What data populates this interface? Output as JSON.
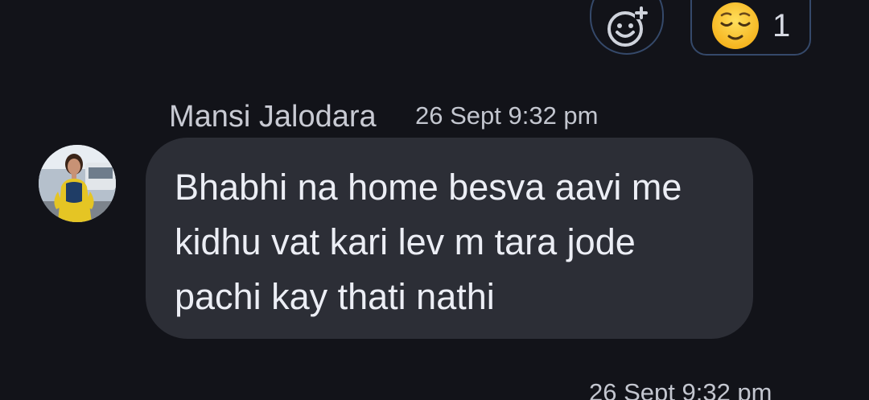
{
  "reactions": {
    "add_reaction_icon": "add-emoji-icon",
    "chip": {
      "emoji_icon": "relieved-face-emoji",
      "count": "1"
    }
  },
  "message": {
    "sender": "Mansi Jalodara",
    "timestamp": "26 Sept 9:32 pm",
    "lines": [
      "Bhabhi na home besva aavi me",
      "kidhu vat kari lev m tara jode",
      "pachi kay thati nathi"
    ]
  },
  "next_message": {
    "timestamp": "26 Sept 9:32 pm"
  },
  "colors": {
    "background": "#121319",
    "bubble": "#2c2e36",
    "chip_border": "#35496a",
    "text_primary": "#eceef5",
    "text_secondary": "#c3c6cf"
  }
}
